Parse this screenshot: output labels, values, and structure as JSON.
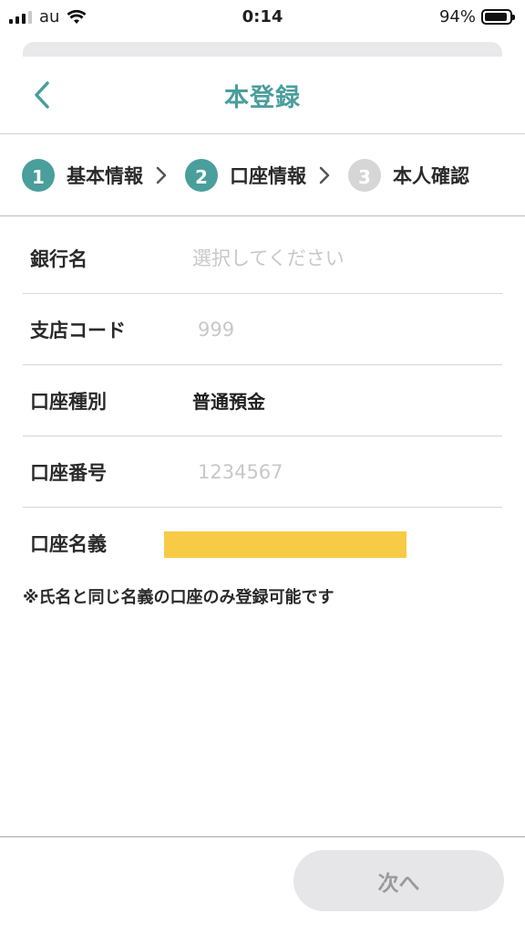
{
  "status_bar": {
    "carrier": "au",
    "time": "0:14",
    "battery_text": "94%",
    "battery_level": 0.94
  },
  "nav": {
    "title": "本登録",
    "back_icon": "chevron-left-icon"
  },
  "stepper": {
    "steps": [
      {
        "number": "1",
        "label": "基本情報",
        "state": "active"
      },
      {
        "number": "2",
        "label": "口座情報",
        "state": "active"
      },
      {
        "number": "3",
        "label": "本人確認",
        "state": "inactive"
      }
    ]
  },
  "form": {
    "bank_name": {
      "label": "銀行名",
      "placeholder": "選択してください"
    },
    "branch_code": {
      "label": "支店コード",
      "placeholder": "999"
    },
    "account_type": {
      "label": "口座種別",
      "value": "普通預金"
    },
    "account_number": {
      "label": "口座番号",
      "placeholder": "1234567"
    },
    "account_holder": {
      "label": "口座名義"
    }
  },
  "note": "※氏名と同じ名義の口座のみ登録可能です",
  "footer": {
    "next_label": "次へ"
  },
  "colors": {
    "accent": "#4a9e9c",
    "inactive": "#d6d6d6",
    "redaction": "#f7cb45",
    "button_disabled_bg": "#e6e6e9"
  }
}
